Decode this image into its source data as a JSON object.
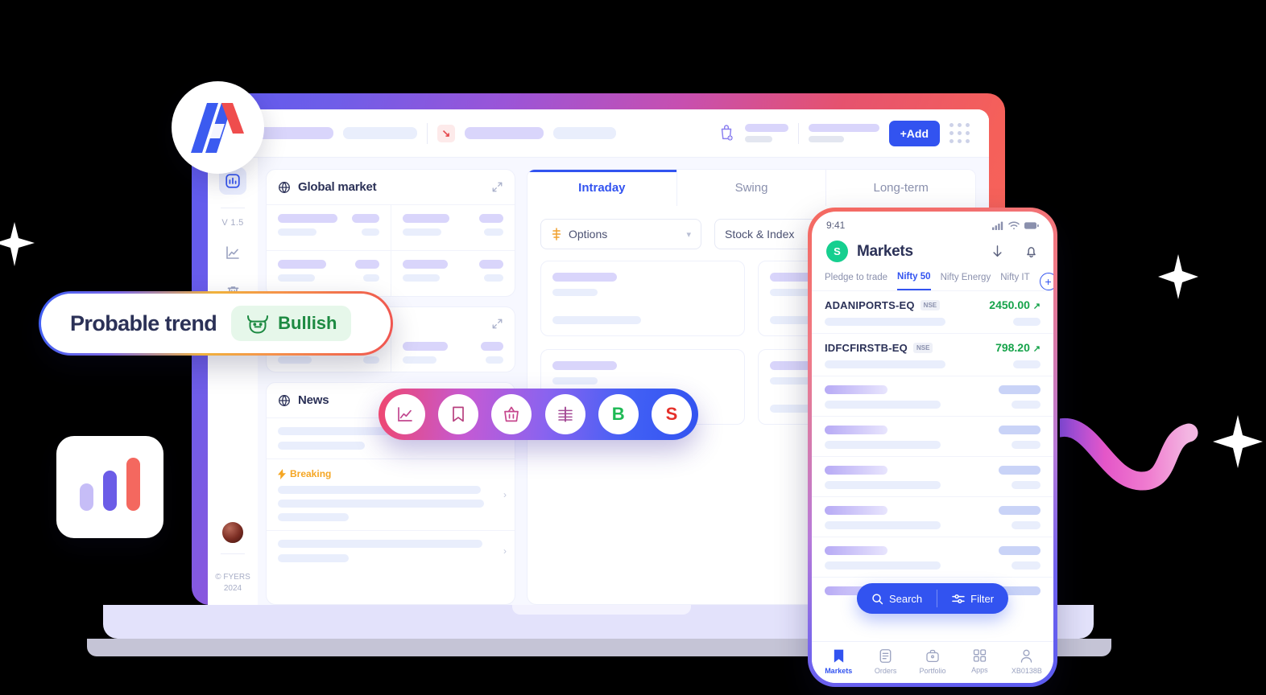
{
  "brand": {
    "logo_name": "fyers-logo",
    "copyright_line1": "© FYERS",
    "copyright_line2": "2024"
  },
  "trend_badge": {
    "label": "Probable trend",
    "icon": "bull-icon",
    "value": "Bullish",
    "value_color": "#1d8a42",
    "chip_bg": "#e6f7ea"
  },
  "bar_card": {
    "name": "bar-chart-icon",
    "bars": [
      "#c6bdf7",
      "#6b5ce7",
      "#f4685f"
    ]
  },
  "desktop": {
    "toolbar": {
      "up_icon": "arrow-up-right-icon",
      "down_icon": "arrow-down-right-icon",
      "cart_icon": "basket-icon",
      "add_label": "+Add",
      "grid_icon": "grid-dots-icon"
    },
    "rail": {
      "items": [
        {
          "name": "dashboard-icon",
          "active": true
        },
        {
          "name": "version-label",
          "label": "V 1.5"
        },
        {
          "name": "chart-icon",
          "active": false
        },
        {
          "name": "trash-icon",
          "active": false
        },
        {
          "name": "logout-icon",
          "active": false
        }
      ]
    },
    "global_market": {
      "title": "Global market",
      "globe_icon": "globe-icon",
      "expand_icon": "expand-icon"
    },
    "news": {
      "title": "News",
      "globe_icon": "globe-icon",
      "breaking_label": "Breaking",
      "breaking_icon": "bolt-icon",
      "chevron_icon": "chevron-right-icon"
    },
    "tabs": [
      {
        "label": "Intraday",
        "active": true
      },
      {
        "label": "Swing",
        "active": false
      },
      {
        "label": "Long-term",
        "active": false
      }
    ],
    "filters": [
      {
        "label": "Options",
        "icon": "options-icon",
        "chevron": "chevron-down-icon"
      },
      {
        "label": "Stock & Index",
        "icon": "",
        "chevron": "chevron-down-icon"
      }
    ]
  },
  "action_pill": {
    "buttons": [
      {
        "name": "chart-icon",
        "label": ""
      },
      {
        "name": "bookmark-icon",
        "label": ""
      },
      {
        "name": "basket-icon",
        "label": ""
      },
      {
        "name": "market-depth-icon",
        "label": ""
      },
      {
        "name": "buy-button",
        "label": "B",
        "color": "#1db954"
      },
      {
        "name": "sell-button",
        "label": "S",
        "color": "#e5302a"
      }
    ]
  },
  "phone": {
    "status": {
      "time": "9:41",
      "signal_icon": "signal-icon",
      "wifi_icon": "wifi-icon",
      "battery_icon": "battery-icon"
    },
    "header": {
      "badge": "S",
      "title": "Markets",
      "download_icon": "download-arrow-icon",
      "bell_icon": "bell-icon"
    },
    "tabs": [
      {
        "label": "Pledge to trade",
        "active": false
      },
      {
        "label": "Nifty 50",
        "active": true
      },
      {
        "label": "Nifty Energy",
        "active": false
      },
      {
        "label": "Nifty IT",
        "active": false
      }
    ],
    "add_icon": "plus-circle-icon",
    "watchlist": [
      {
        "symbol": "ADANIPORTS-EQ",
        "exchange": "NSE",
        "price": "2450.00",
        "arrow": "▲",
        "color": "#16a34a"
      },
      {
        "symbol": "IDFCFIRSTB-EQ",
        "exchange": "NSE",
        "price": "798.20",
        "arrow": "▲",
        "color": "#16a34a"
      }
    ],
    "search_bar": {
      "search_label": "Search",
      "search_icon": "search-icon",
      "filter_label": "Filter",
      "filter_icon": "filter-icon"
    },
    "tabbar": [
      {
        "label": "Markets",
        "icon": "bookmark-icon",
        "active": true
      },
      {
        "label": "Orders",
        "icon": "orders-icon",
        "active": false
      },
      {
        "label": "Portfolio",
        "icon": "briefcase-icon",
        "active": false
      },
      {
        "label": "Apps",
        "icon": "grid-icon",
        "active": false
      },
      {
        "label": "XB0138B",
        "icon": "user-icon",
        "active": false
      }
    ]
  }
}
